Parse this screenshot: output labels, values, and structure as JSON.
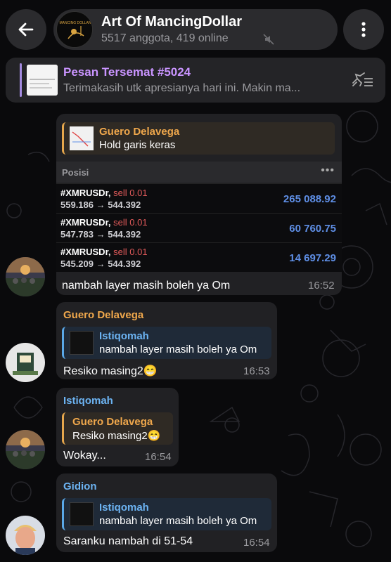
{
  "header": {
    "title": "Art Of MancingDollar",
    "subtitle": "5517 anggota, 419 online"
  },
  "pinned": {
    "title": "Pesan Tersemat #5024",
    "text": "Terimakasih utk apresianya hari ini. Makin ma..."
  },
  "msg1": {
    "reply_name": "Guero Delavega",
    "reply_text": "Hold garis keras",
    "positions_title": "Posisi",
    "positions_menu": "•••",
    "rows": [
      {
        "symbol": "#XMRUSDr,",
        "side": "sell 0.01",
        "prices": "559.186 → 544.392",
        "profit": "265 088.92"
      },
      {
        "symbol": "#XMRUSDr,",
        "side": "sell 0.01",
        "prices": "547.783 → 544.392",
        "profit": "60 760.75"
      },
      {
        "symbol": "#XMRUSDr,",
        "side": "sell 0.01",
        "prices": "545.209 → 544.392",
        "profit": "14 697.29"
      }
    ],
    "text": "nambah layer masih boleh ya Om",
    "time": "16:52"
  },
  "msg2": {
    "sender": "Guero Delavega",
    "reply_name": "Istiqomah",
    "reply_text": "nambah layer masih boleh ya Om",
    "text": "Resiko masing2😁",
    "time": "16:53"
  },
  "msg3": {
    "sender": "Istiqomah",
    "reply_name": "Guero Delavega",
    "reply_text": "Resiko masing2😁",
    "text": "Wokay...",
    "time": "16:54"
  },
  "msg4": {
    "sender": "Gidion",
    "reply_name": "Istiqomah",
    "reply_text": "nambah layer masih boleh ya Om",
    "text": "Saranku nambah di 51-54",
    "time": "16:54"
  },
  "colors": {
    "orange_name": "#f0a84c",
    "blue_name": "#6cb3f2",
    "pinned_accent": "#c994ff",
    "profit": "#5f8fe6",
    "sell": "#e05a5a"
  }
}
